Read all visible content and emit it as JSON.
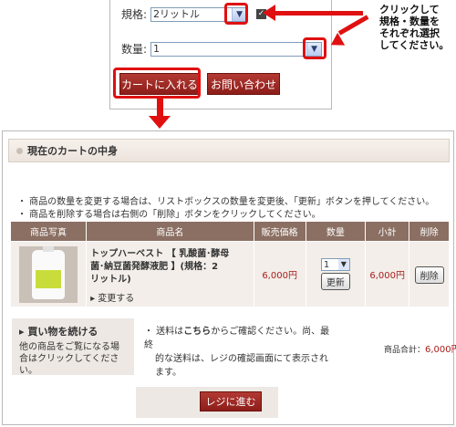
{
  "top": {
    "spec_label": "規格:",
    "spec_value": "2リットル",
    "qty_label": "数量:",
    "qty_value": "1",
    "add_to_cart": "カートに入れる",
    "inquiry": "お問い合わせ"
  },
  "callout": [
    "クリックして",
    "規格・数量を",
    "それぞれ選択",
    "してください。"
  ],
  "cart": {
    "header": "現在のカートの中身",
    "notes": [
      "・ 商品の数量を変更する場合は、リストボックスの数量を変更後、「更新」ボタンを押してください。",
      "・ 商品を削除する場合は右側の「削除」ボタンをクリックしてください。"
    ],
    "columns": [
      "商品写真",
      "商品名",
      "販売価格",
      "数量",
      "小計",
      "削除"
    ],
    "item": {
      "name_lines": [
        "トップハーベスト 【 乳酸菌･酵母",
        "菌･納豆菌発酵液肥 】(規格：2",
        "リットル)"
      ],
      "change": "変更する",
      "price": "6,000円",
      "qty": "1",
      "update": "更新",
      "subtotal": "6,000円",
      "delete": "削除"
    },
    "continue_title": "買い物を続ける",
    "continue_text": [
      "他の商品をご覧になる場",
      "合はクリックしてください。"
    ],
    "shipping_pre": "・ 送料は",
    "shipping_link": "こちら",
    "shipping_post": "からご確認ください。尚、最終",
    "shipping_line2": "的な送料は、レジの確認画面にて表示され",
    "shipping_line3": "ます。",
    "subtotal_label": "商品合計：",
    "subtotal_value": "6,000円",
    "checkout": "レジに進む"
  },
  "colors": {
    "accent_red": "#e01010",
    "button_brown": "#9b2621",
    "table_header": "#8b6f62"
  }
}
